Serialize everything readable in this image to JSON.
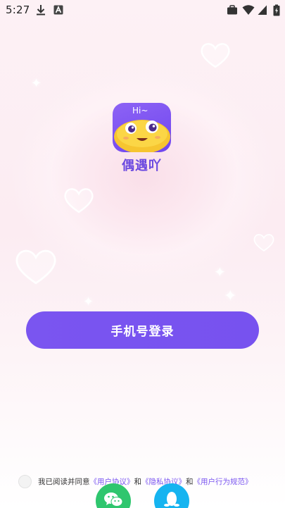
{
  "status_bar": {
    "time": "5:27",
    "left_icons": [
      "download-icon",
      "a-badge-icon"
    ],
    "right_icons": [
      "briefcase-icon",
      "wifi-icon",
      "signal-icon",
      "battery-icon"
    ]
  },
  "app": {
    "logo_text": "Hi~",
    "name": "偶遇吖"
  },
  "login": {
    "phone_login_label": "手机号登录"
  },
  "agreement": {
    "prefix": "我已阅读并同意",
    "user_agreement": "《用户协议》",
    "and1": "和",
    "privacy_agreement": "《隐私协议》",
    "and2": "和",
    "conduct_rules": "《用户行为规范》",
    "checked": false
  },
  "social_login": [
    {
      "name": "wechat",
      "icon": "wechat-icon",
      "color": "#2fc66e"
    },
    {
      "name": "qq",
      "icon": "qq-penguin-icon",
      "color": "#16b4f0"
    }
  ],
  "colors": {
    "accent": "#7a55f0",
    "background_pink": "#fcecf2"
  }
}
